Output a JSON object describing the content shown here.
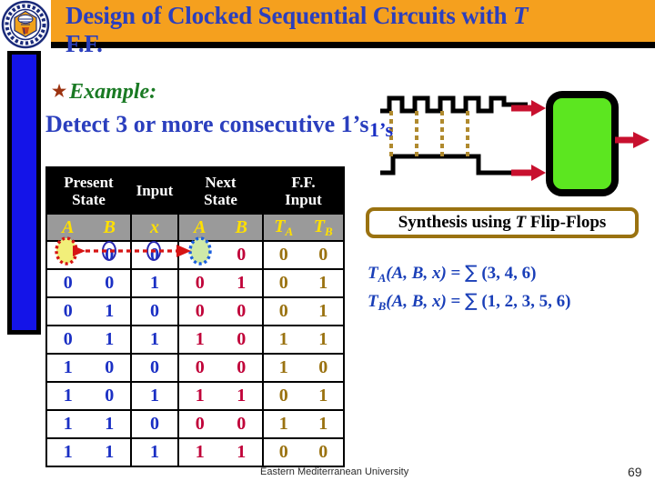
{
  "slide": {
    "title_main": "Design of Clocked Sequential Circuits with ",
    "title_italic": "T",
    "title_line2": "F.F.",
    "banner_color": "#f5a01e",
    "title_color": "#2b3fbe"
  },
  "logo": {
    "name": "emu-university-logo"
  },
  "example": {
    "star": "★",
    "label": "Example:",
    "label_color": "#1a7a24",
    "statement": "Detect 3 or more consecutive 1’s",
    "statement_color": "#2b3fbe"
  },
  "table": {
    "group_headers": [
      {
        "line1": "Present",
        "line2": "State"
      },
      {
        "line1": "Input",
        "line2": ""
      },
      {
        "line1": "Next",
        "line2": "State"
      },
      {
        "line1": "F.F.",
        "line2": "Input"
      }
    ],
    "variable_headers": {
      "present_state": [
        "A",
        "B"
      ],
      "input": [
        "x"
      ],
      "next_state": [
        "A",
        "B"
      ],
      "ff_input": [
        "T",
        "T"
      ],
      "ff_input_subs": [
        "A",
        "B"
      ]
    },
    "rows": [
      {
        "present": [
          "0",
          "0"
        ],
        "input": "0",
        "next": [
          "0",
          "0"
        ],
        "ff": [
          "0",
          "0"
        ]
      },
      {
        "present": [
          "0",
          "0"
        ],
        "input": "1",
        "next": [
          "0",
          "1"
        ],
        "ff": [
          "0",
          "1"
        ]
      },
      {
        "present": [
          "0",
          "1"
        ],
        "input": "0",
        "next": [
          "0",
          "0"
        ],
        "ff": [
          "0",
          "1"
        ]
      },
      {
        "present": [
          "0",
          "1"
        ],
        "input": "1",
        "next": [
          "1",
          "0"
        ],
        "ff": [
          "1",
          "1"
        ]
      },
      {
        "present": [
          "1",
          "0"
        ],
        "input": "0",
        "next": [
          "0",
          "0"
        ],
        "ff": [
          "1",
          "0"
        ]
      },
      {
        "present": [
          "1",
          "0"
        ],
        "input": "1",
        "next": [
          "1",
          "1"
        ],
        "ff": [
          "0",
          "1"
        ]
      },
      {
        "present": [
          "1",
          "1"
        ],
        "input": "0",
        "next": [
          "0",
          "0"
        ],
        "ff": [
          "1",
          "1"
        ]
      },
      {
        "present": [
          "1",
          "1"
        ],
        "input": "1",
        "next": [
          "1",
          "1"
        ],
        "ff": [
          "0",
          "0"
        ]
      }
    ],
    "colors": {
      "header_bg": "#000000",
      "header_fg": "#ffffff",
      "subheader_bg": "#9a9a9a",
      "subheader_fg": "#ffe000",
      "present_state": "#1a2fc4",
      "input": "#1a2fc4",
      "next_state": "#c00038",
      "ff_input": "#9a7210",
      "highlight_source": "#d61414",
      "highlight_target": "#1a5fe0",
      "highlight_fill": "#f2ef7a"
    }
  },
  "waveform": {
    "ones_label": "1’s",
    "clock_pulses": 4,
    "dashed_line_color": "#b08a2e",
    "signal_color": "#000000",
    "arrow_color": "#c8102e",
    "block_fill": "#5ce620",
    "block_border": "#000000"
  },
  "synthesis": {
    "text_before": "Synthesis using ",
    "text_italic": "T",
    "text_after": " Flip-Flops",
    "border_color": "#9a7210"
  },
  "equations": {
    "line1": {
      "fn": "T",
      "sub": "A",
      "args": "(A, B, x)",
      "eq": " = ",
      "sum": "∑",
      "terms": " (3, 4, 6)"
    },
    "line2": {
      "fn": "T",
      "sub": "B",
      "args": "(A, B, x)",
      "eq": " = ",
      "sum": "∑",
      "terms": " (1, 2, 3, 5, 6)"
    },
    "color": "#1a3fb8"
  },
  "footer": {
    "organization": "Eastern Mediterranean University",
    "page_number": "69"
  }
}
